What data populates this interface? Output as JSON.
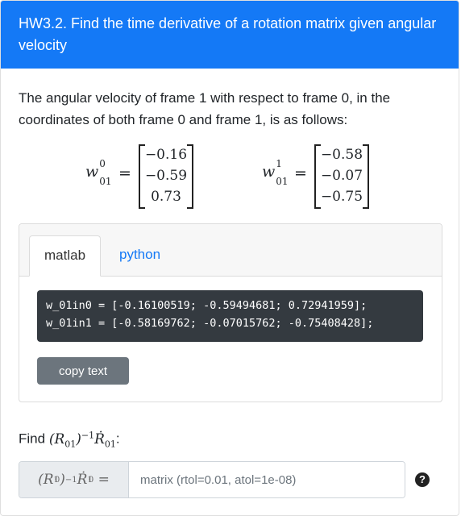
{
  "header": {
    "title": "HW3.2. Find the time derivative of a rotation matrix given angular velocity"
  },
  "intro": {
    "text": "The angular velocity of frame 1 with respect to frame 0, in the coordinates of both frame 0 and frame 1, is as follows:"
  },
  "math": {
    "w0": {
      "symbol": "w",
      "sub": "01",
      "sup": "0",
      "values": [
        "−0.16",
        "−0.59",
        "0.73"
      ]
    },
    "w1": {
      "symbol": "w",
      "sub": "01",
      "sup": "1",
      "values": [
        "−0.58",
        "−0.07",
        "−0.75"
      ]
    },
    "equals": "="
  },
  "tabs": [
    {
      "label": "matlab",
      "active": true
    },
    {
      "label": "python",
      "active": false
    }
  ],
  "code": {
    "line1": "w_01in0 = [-0.16100519; -0.59494681; 0.72941959];",
    "line2": "w_01in1 = [-0.58169762; -0.07015762; -0.75408428];"
  },
  "copy_button": {
    "label": "copy text"
  },
  "find": {
    "prefix": "Find"
  },
  "answer": {
    "placeholder": "matrix (rtol=0.01, atol=1e-08)",
    "value": ""
  },
  "help_icon": {
    "glyph": "?",
    "name": "question-circle-icon"
  },
  "colors": {
    "header_bg": "#1479f6",
    "link": "#1479f6",
    "code_bg": "#343a40",
    "button_bg": "#6c757d"
  }
}
